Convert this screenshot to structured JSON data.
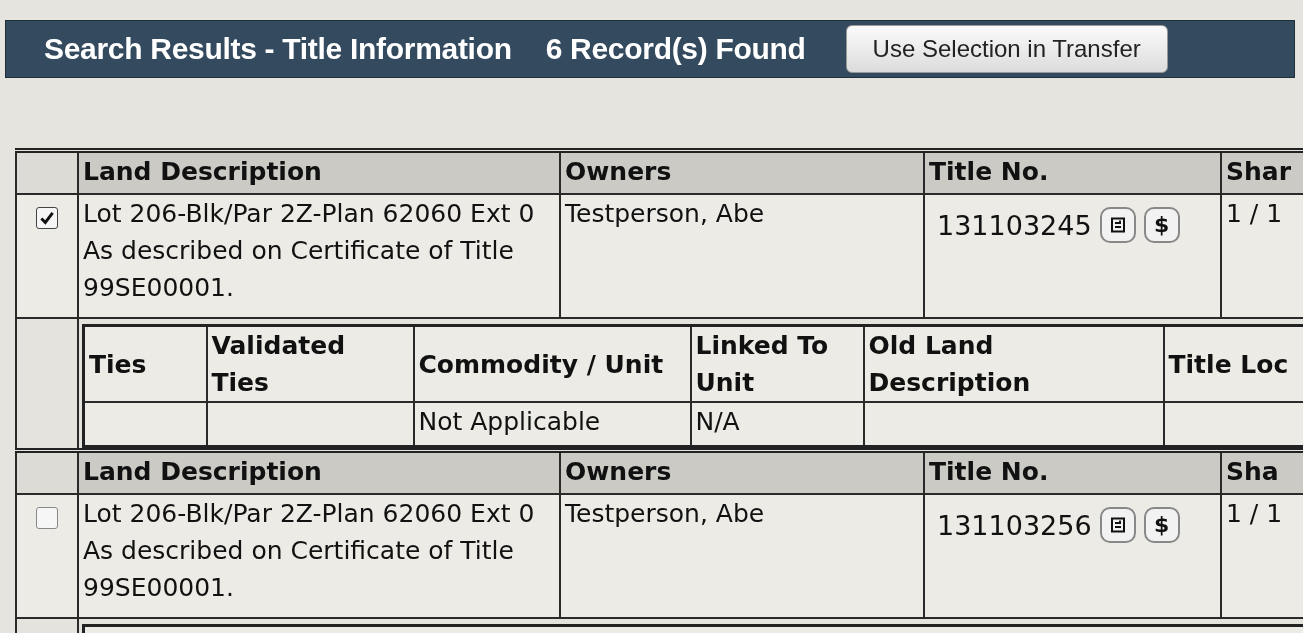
{
  "header": {
    "title": "Search Results - Title Information",
    "count": "6 Record(s) Found",
    "button": "Use Selection in Transfer"
  },
  "records": [
    {
      "checked": true,
      "headers": [
        "Land Description",
        "Owners",
        "Title No.",
        "Shar"
      ],
      "land_description": "Lot 206-Blk/Par 2Z-Plan 62060 Ext 0 As described on Certificate of Title 99SE00001.",
      "owners": "Testperson, Abe",
      "title_no": "131103245",
      "fee_label": "$",
      "share": "1 / 1",
      "details": {
        "headers": [
          "Ties",
          "Validated Ties",
          "Commodity / Unit",
          "Linked To Unit",
          "Old Land Description",
          "Title Loc"
        ],
        "cells": [
          null,
          null,
          "Not Applicable",
          "N/A",
          null,
          null
        ]
      }
    },
    {
      "checked": false,
      "headers": [
        "Land Description",
        "Owners",
        "Title No.",
        "Sha"
      ],
      "land_description": "Lot 206-Blk/Par 2Z-Plan 62060 Ext 0 As described on Certificate of Title 99SE00001.",
      "owners": "Testperson, Abe",
      "title_no": "131103256",
      "fee_label": "$",
      "share": "1 / 1"
    }
  ]
}
